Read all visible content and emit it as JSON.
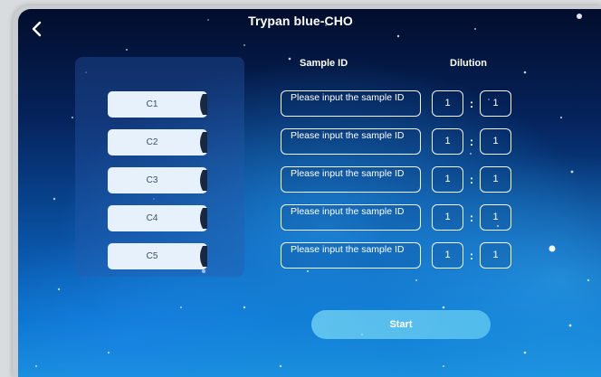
{
  "header": {
    "title": "Trypan blue-CHO",
    "back_icon": "chevron-left-icon"
  },
  "columns": {
    "sample_id": "Sample ID",
    "dilution": "Dilution"
  },
  "chambers": [
    {
      "label": "C1",
      "sample_placeholder": "Please input the sample ID",
      "dil_a": "1",
      "dil_b": "1"
    },
    {
      "label": "C2",
      "sample_placeholder": "Please input the sample ID",
      "dil_a": "1",
      "dil_b": "1"
    },
    {
      "label": "C3",
      "sample_placeholder": "Please input the sample ID",
      "dil_a": "1",
      "dil_b": "1"
    },
    {
      "label": "C4",
      "sample_placeholder": "Please input the sample ID",
      "dil_a": "1",
      "dil_b": "1"
    },
    {
      "label": "C5",
      "sample_placeholder": "Please input the sample ID",
      "dil_a": "1",
      "dil_b": "1"
    }
  ],
  "dilution_separator": ":",
  "actions": {
    "start_label": "Start"
  },
  "colors": {
    "accent": "#6fd0f2",
    "chamber_bg": "#e6f1fb",
    "chamber_cap": "#1a2740"
  }
}
